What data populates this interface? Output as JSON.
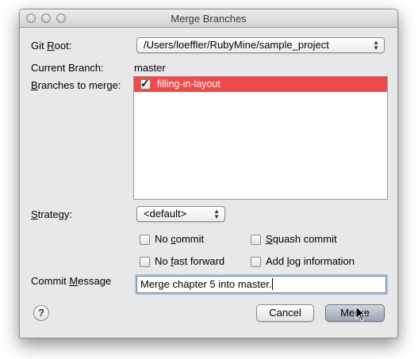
{
  "window": {
    "title": "Merge Branches"
  },
  "git_root": {
    "label_pre": "Git ",
    "label_key": "R",
    "label_post": "oot:",
    "value": "/Users/loeffler/RubyMine/sample_project"
  },
  "current_branch": {
    "label": "Current Branch:",
    "value": "master"
  },
  "branches": {
    "label_key": "B",
    "label_post": "ranches to merge:",
    "items": [
      {
        "name": "filling-in-layout",
        "checked": true
      }
    ]
  },
  "strategy": {
    "label_key": "S",
    "label_post": "trategy:",
    "value": "<default>"
  },
  "options": {
    "no_commit": {
      "pre": "No ",
      "key": "c",
      "post": "ommit",
      "checked": false
    },
    "squash_commit": {
      "pre": "",
      "key": "S",
      "post": "quash commit",
      "checked": false
    },
    "no_fast_forward": {
      "pre": "No ",
      "key": "f",
      "post": "ast forward",
      "checked": false
    },
    "add_log": {
      "pre": "Add ",
      "key": "l",
      "post": "og information",
      "checked": false
    }
  },
  "commit_message": {
    "label_pre": "Commit ",
    "label_key": "M",
    "label_post": "essage",
    "value": "Merge chapter 5 into master."
  },
  "buttons": {
    "help": "?",
    "cancel": "Cancel",
    "merge": "Merge"
  },
  "colors": {
    "selection": "#ef4a4b",
    "default_button": "#9aa6b6"
  }
}
